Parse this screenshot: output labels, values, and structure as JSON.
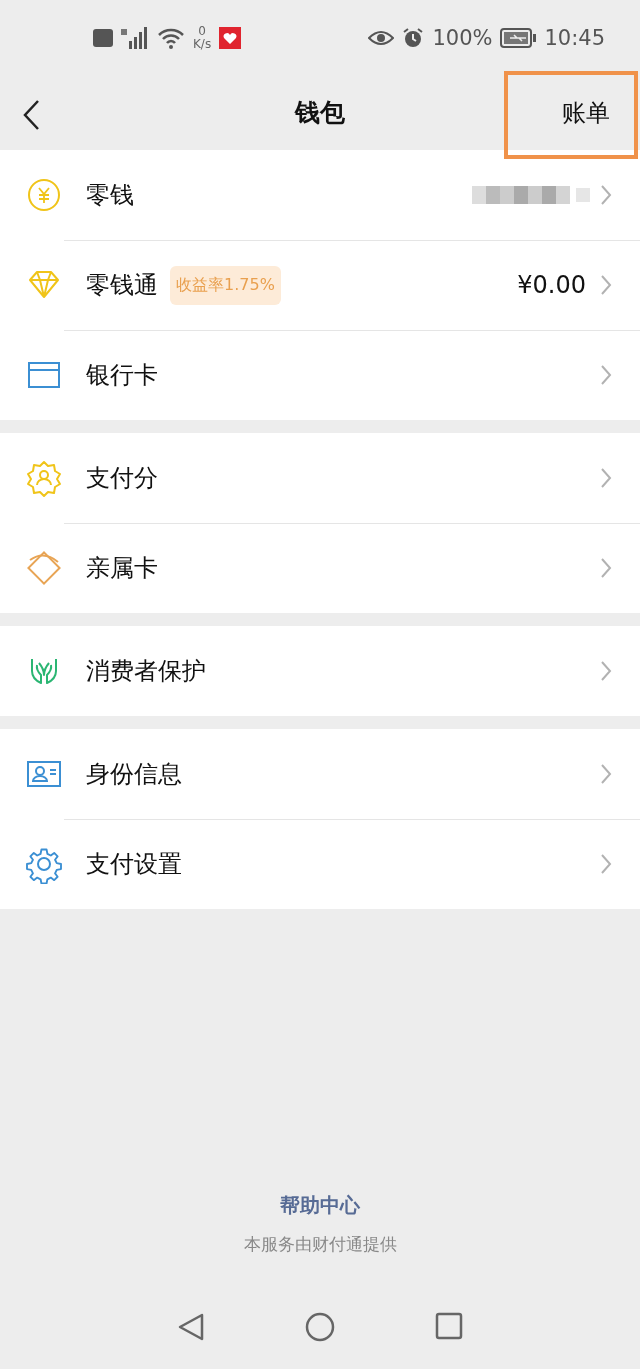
{
  "status_bar": {
    "net_speed_value": "0",
    "net_speed_unit": "K/s",
    "battery": "100%",
    "time": "10:45"
  },
  "header": {
    "title": "钱包",
    "action": {
      "label": "账单",
      "highlighted": true
    }
  },
  "groups": [
    {
      "items": [
        {
          "label": "零钱",
          "amount_obscured": true
        },
        {
          "label": "零钱通",
          "badge": "收益率1.75%",
          "amount": "¥0.00"
        },
        {
          "label": "银行卡"
        }
      ]
    },
    {
      "items": [
        {
          "label": "支付分"
        },
        {
          "label": "亲属卡"
        }
      ]
    },
    {
      "items": [
        {
          "label": "消费者保护"
        }
      ]
    },
    {
      "items": [
        {
          "label": "身份信息"
        },
        {
          "label": "支付设置"
        }
      ]
    }
  ],
  "footer": {
    "link": "帮助中心",
    "note": "本服务由财付通提供"
  }
}
